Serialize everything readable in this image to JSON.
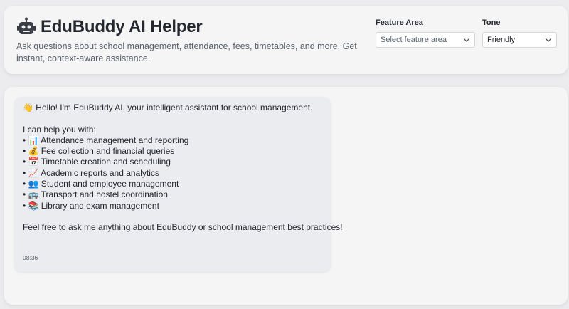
{
  "header": {
    "title": "EduBuddy AI Helper",
    "subtitle": "Ask questions about school management, attendance, fees, timetables, and more. Get instant, context-aware assistance.",
    "feature_area": {
      "label": "Feature Area",
      "placeholder": "Select feature area"
    },
    "tone": {
      "label": "Tone",
      "value": "Friendly"
    }
  },
  "chat": {
    "message": {
      "greeting": "👋 Hello! I'm EduBuddy AI, your intelligent assistant for school management.",
      "intro": "I can help you with:",
      "items": [
        "• 📊 Attendance management and reporting",
        "• 💰 Fee collection and financial queries",
        "• 📅 Timetable creation and scheduling",
        "• 📈 Academic reports and analytics",
        "• 👥 Student and employee management",
        "• 🚌 Transport and hostel coordination",
        "• 📚 Library and exam management"
      ],
      "closing": "Feel free to ask me anything about EduBuddy or school management best practices!",
      "time": "08:36"
    }
  }
}
